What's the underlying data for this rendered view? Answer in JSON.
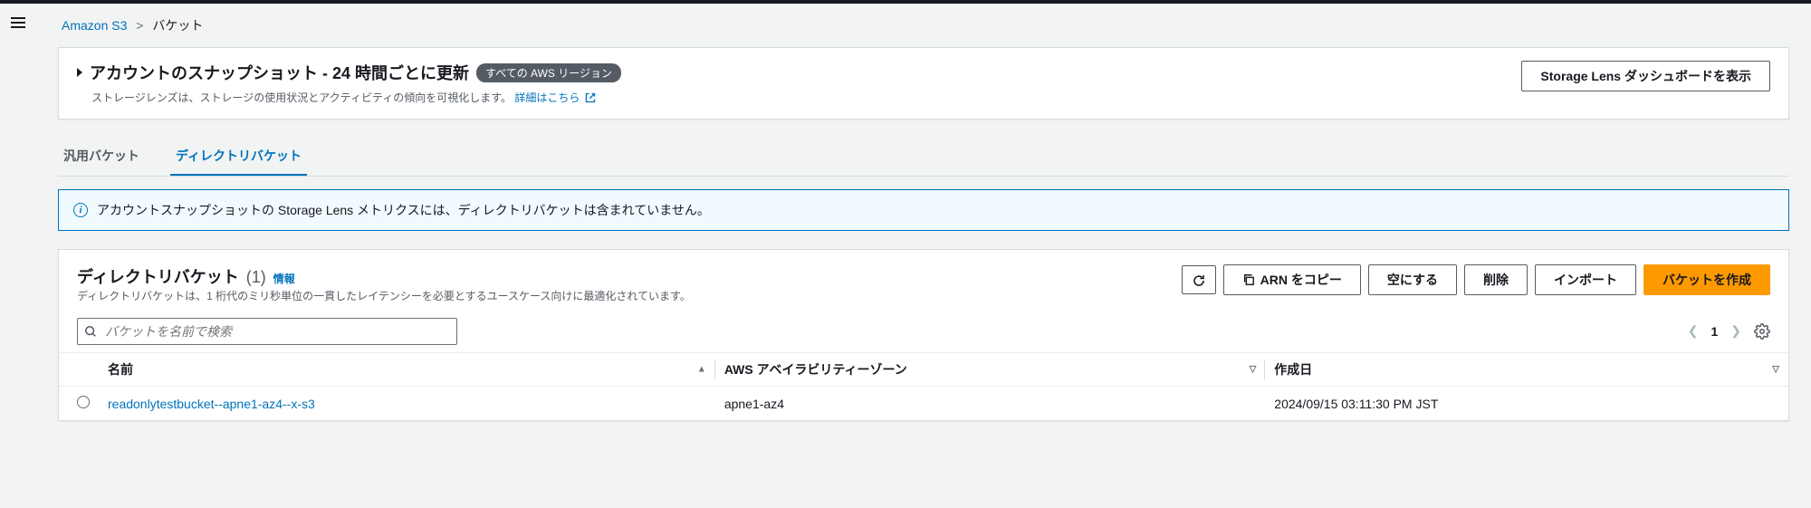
{
  "breadcrumb": {
    "root": "Amazon S3",
    "current": "バケット"
  },
  "snapshot": {
    "title": "アカウントのスナップショット - 24 時間ごとに更新",
    "badge": "すべての AWS リージョン",
    "description_prefix": "ストレージレンズは、ストレージの使用状況とアクティビティの傾向を可視化します。",
    "learn_more": "詳細はこちら",
    "dashboard_button": "Storage Lens ダッシュボードを表示"
  },
  "tabs": {
    "general": "汎用バケット",
    "directory": "ディレクトリバケット"
  },
  "info_banner": "アカウントスナップショットの Storage Lens メトリクスには、ディレクトリバケットは含まれていません。",
  "section": {
    "title": "ディレクトリバケット",
    "count": "(1)",
    "info_link": "情報",
    "description": "ディレクトリバケットは、1 桁代のミリ秒単位の一貫したレイテンシーを必要とするユースケース向けに最適化されています。"
  },
  "actions": {
    "copy_arn": "ARN をコピー",
    "empty": "空にする",
    "delete": "削除",
    "import": "インポート",
    "create": "バケットを作成"
  },
  "search": {
    "placeholder": "バケットを名前で検索"
  },
  "pagination": {
    "page": "1"
  },
  "table": {
    "headers": {
      "name": "名前",
      "az": "AWS アベイラビリティーゾーン",
      "created": "作成日"
    },
    "rows": [
      {
        "name": "readonlytestbucket--apne1-az4--x-s3",
        "az": "apne1-az4",
        "created": "2024/09/15 03:11:30 PM JST"
      }
    ]
  }
}
